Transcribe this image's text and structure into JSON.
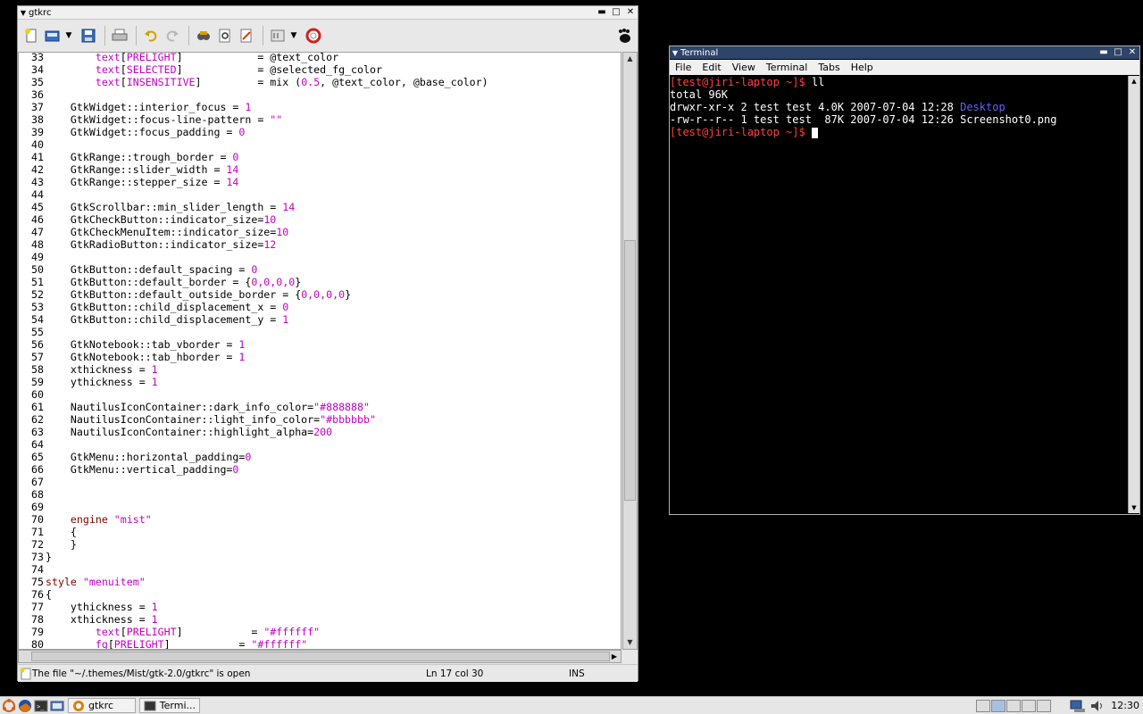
{
  "editor": {
    "title": "gtkrc",
    "status_message": "The file \"~/.themes/Mist/gtk-2.0/gtkrc\" is open",
    "cursor_position": "Ln 17 col 30",
    "insert_mode": "INS",
    "lines": [
      {
        "n": "33",
        "parts": [
          [
            "",
            "        "
          ],
          [
            "str",
            "text"
          ],
          [
            "",
            "["
          ],
          [
            "str",
            "PRELIGHT"
          ],
          [
            "",
            "]            = @text_color"
          ]
        ]
      },
      {
        "n": "34",
        "parts": [
          [
            "",
            "        "
          ],
          [
            "str",
            "text"
          ],
          [
            "",
            "["
          ],
          [
            "str",
            "SELECTED"
          ],
          [
            "",
            "]            = @selected_fg_color"
          ]
        ]
      },
      {
        "n": "35",
        "parts": [
          [
            "",
            "        "
          ],
          [
            "str",
            "text"
          ],
          [
            "",
            "["
          ],
          [
            "str",
            "INSENSITIVE"
          ],
          [
            "",
            "]         = mix ("
          ],
          [
            "str",
            "0.5"
          ],
          [
            "",
            ", @text_color, @base_color)"
          ]
        ]
      },
      {
        "n": "36",
        "parts": []
      },
      {
        "n": "37",
        "parts": [
          [
            "",
            "    GtkWidget::interior_focus = "
          ],
          [
            "str",
            "1"
          ]
        ]
      },
      {
        "n": "38",
        "parts": [
          [
            "",
            "    GtkWidget::focus-line-pattern = "
          ],
          [
            "str",
            "\"\""
          ]
        ]
      },
      {
        "n": "39",
        "parts": [
          [
            "",
            "    GtkWidget::focus_padding = "
          ],
          [
            "str",
            "0"
          ]
        ]
      },
      {
        "n": "40",
        "parts": []
      },
      {
        "n": "41",
        "parts": [
          [
            "",
            "    GtkRange::trough_border = "
          ],
          [
            "str",
            "0"
          ]
        ]
      },
      {
        "n": "42",
        "parts": [
          [
            "",
            "    GtkRange::slider_width = "
          ],
          [
            "str",
            "14"
          ]
        ]
      },
      {
        "n": "43",
        "parts": [
          [
            "",
            "    GtkRange::stepper_size = "
          ],
          [
            "str",
            "14"
          ]
        ]
      },
      {
        "n": "44",
        "parts": []
      },
      {
        "n": "45",
        "parts": [
          [
            "",
            "    GtkScrollbar::min_slider_length = "
          ],
          [
            "str",
            "14"
          ]
        ]
      },
      {
        "n": "46",
        "parts": [
          [
            "",
            "    GtkCheckButton::indicator_size="
          ],
          [
            "str",
            "10"
          ]
        ]
      },
      {
        "n": "47",
        "parts": [
          [
            "",
            "    GtkCheckMenuItem::indicator_size="
          ],
          [
            "str",
            "10"
          ]
        ]
      },
      {
        "n": "48",
        "parts": [
          [
            "",
            "    GtkRadioButton::indicator_size="
          ],
          [
            "str",
            "12"
          ]
        ]
      },
      {
        "n": "49",
        "parts": []
      },
      {
        "n": "50",
        "parts": [
          [
            "",
            "    GtkButton::default_spacing = "
          ],
          [
            "str",
            "0"
          ]
        ]
      },
      {
        "n": "51",
        "parts": [
          [
            "",
            "    GtkButton::default_border = {"
          ],
          [
            "str",
            "0,0,0,0"
          ],
          [
            "",
            "}"
          ]
        ]
      },
      {
        "n": "52",
        "parts": [
          [
            "",
            "    GtkButton::default_outside_border = {"
          ],
          [
            "str",
            "0,0,0,0"
          ],
          [
            "",
            "}"
          ]
        ]
      },
      {
        "n": "53",
        "parts": [
          [
            "",
            "    GtkButton::child_displacement_x = "
          ],
          [
            "str",
            "0"
          ]
        ]
      },
      {
        "n": "54",
        "parts": [
          [
            "",
            "    GtkButton::child_displacement_y = "
          ],
          [
            "str",
            "1"
          ]
        ]
      },
      {
        "n": "55",
        "parts": []
      },
      {
        "n": "56",
        "parts": [
          [
            "",
            "    GtkNotebook::tab_vborder = "
          ],
          [
            "str",
            "1"
          ]
        ]
      },
      {
        "n": "57",
        "parts": [
          [
            "",
            "    GtkNotebook::tab_hborder = "
          ],
          [
            "str",
            "1"
          ]
        ]
      },
      {
        "n": "58",
        "parts": [
          [
            "",
            "    xthickness = "
          ],
          [
            "str",
            "1"
          ]
        ]
      },
      {
        "n": "59",
        "parts": [
          [
            "",
            "    ythickness = "
          ],
          [
            "str",
            "1"
          ]
        ]
      },
      {
        "n": "60",
        "parts": []
      },
      {
        "n": "61",
        "parts": [
          [
            "",
            "    NautilusIconContainer::dark_info_color="
          ],
          [
            "str",
            "\"#888888\""
          ]
        ]
      },
      {
        "n": "62",
        "parts": [
          [
            "",
            "    NautilusIconContainer::light_info_color="
          ],
          [
            "str",
            "\"#bbbbbb\""
          ]
        ]
      },
      {
        "n": "63",
        "parts": [
          [
            "",
            "    NautilusIconContainer::highlight_alpha="
          ],
          [
            "str",
            "200"
          ]
        ]
      },
      {
        "n": "64",
        "parts": []
      },
      {
        "n": "65",
        "parts": [
          [
            "",
            "    GtkMenu::horizontal_padding="
          ],
          [
            "str",
            "0"
          ]
        ]
      },
      {
        "n": "66",
        "parts": [
          [
            "",
            "    GtkMenu::vertical_padding="
          ],
          [
            "str",
            "0"
          ]
        ]
      },
      {
        "n": "67",
        "parts": []
      },
      {
        "n": "68",
        "parts": []
      },
      {
        "n": "69",
        "parts": []
      },
      {
        "n": "70",
        "parts": [
          [
            "",
            "    "
          ],
          [
            "kw",
            "engine"
          ],
          [
            "",
            " "
          ],
          [
            "str",
            "\"mist\""
          ]
        ]
      },
      {
        "n": "71",
        "parts": [
          [
            "",
            "    {"
          ]
        ]
      },
      {
        "n": "72",
        "parts": [
          [
            "",
            "    }"
          ]
        ]
      },
      {
        "n": "73",
        "parts": [
          [
            "",
            "}"
          ]
        ]
      },
      {
        "n": "74",
        "parts": []
      },
      {
        "n": "75",
        "parts": [
          [
            "kw",
            "style"
          ],
          [
            "",
            " "
          ],
          [
            "str",
            "\"menuitem\""
          ]
        ]
      },
      {
        "n": "76",
        "parts": [
          [
            "",
            "{"
          ]
        ]
      },
      {
        "n": "77",
        "parts": [
          [
            "",
            "    ythickness = "
          ],
          [
            "str",
            "1"
          ]
        ]
      },
      {
        "n": "78",
        "parts": [
          [
            "",
            "    xthickness = "
          ],
          [
            "str",
            "1"
          ]
        ]
      },
      {
        "n": "79",
        "parts": [
          [
            "",
            "        "
          ],
          [
            "str",
            "text"
          ],
          [
            "",
            "["
          ],
          [
            "str",
            "PRELIGHT"
          ],
          [
            "",
            "]           = "
          ],
          [
            "str",
            "\"#ffffff\""
          ]
        ]
      },
      {
        "n": "80",
        "parts": [
          [
            "",
            "        "
          ],
          [
            "str",
            "fg"
          ],
          [
            "",
            "["
          ],
          [
            "str",
            "PRELIGHT"
          ],
          [
            "",
            "]           = "
          ],
          [
            "str",
            "\"#ffffff\""
          ]
        ]
      }
    ]
  },
  "terminal": {
    "title": "Terminal",
    "menu": [
      "File",
      "Edit",
      "View",
      "Terminal",
      "Tabs",
      "Help"
    ],
    "prompt": "[test@jiri-laptop ~]$ ",
    "command": "ll",
    "total": "total 96K",
    "row1_prefix": "drwxr-xr-x 2 test test 4.0K 2007-07-04 12:28 ",
    "row1_dir": "Desktop",
    "row2": "-rw-r--r-- 1 test test  87K 2007-07-04 12:26 Screenshot0.png"
  },
  "taskbar": {
    "task_editor": "gtkrc",
    "task_terminal": "Termi...",
    "clock": "12:30"
  }
}
